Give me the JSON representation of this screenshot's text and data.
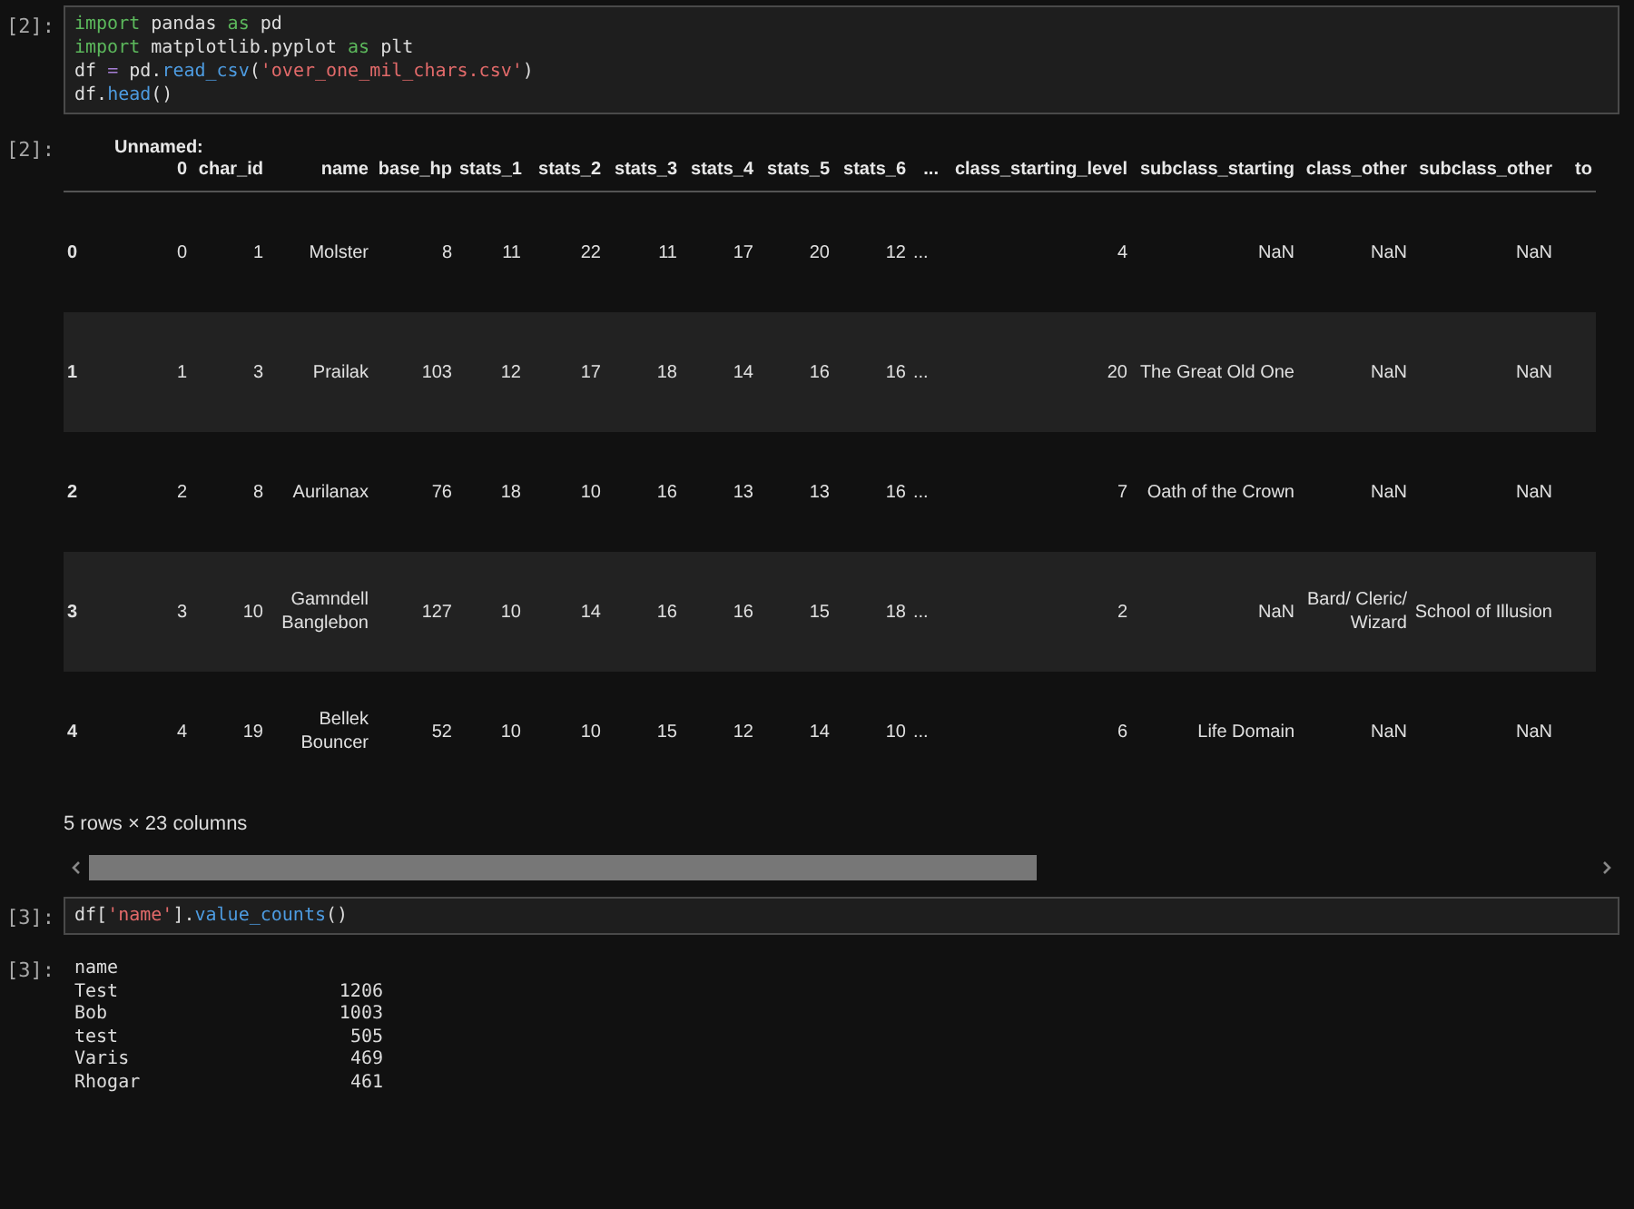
{
  "cells": [
    {
      "kind": "code",
      "prompt": "[2]:",
      "lines": [
        [
          {
            "text": "import",
            "kind": "keyword"
          },
          {
            "text": " pandas ",
            "kind": "plain"
          },
          {
            "text": "as",
            "kind": "keyword"
          },
          {
            "text": " pd",
            "kind": "plain"
          }
        ],
        [
          {
            "text": "import",
            "kind": "keyword"
          },
          {
            "text": " matplotlib.pyplot ",
            "kind": "plain"
          },
          {
            "text": "as",
            "kind": "keyword"
          },
          {
            "text": " plt",
            "kind": "plain"
          }
        ],
        [
          {
            "text": "df ",
            "kind": "plain"
          },
          {
            "text": "=",
            "kind": "operator"
          },
          {
            "text": " pd.",
            "kind": "plain"
          },
          {
            "text": "read_csv",
            "kind": "function"
          },
          {
            "text": "(",
            "kind": "plain"
          },
          {
            "text": "'over_one_mil_chars.csv'",
            "kind": "string"
          },
          {
            "text": ")",
            "kind": "plain"
          }
        ],
        [
          {
            "text": "df.",
            "kind": "plain"
          },
          {
            "text": "head",
            "kind": "function"
          },
          {
            "text": "()",
            "kind": "plain"
          }
        ]
      ]
    },
    {
      "kind": "table",
      "prompt": "[2]:",
      "columns": [
        "",
        "Unnamed: 0",
        "char_id",
        "name",
        "base_hp",
        "stats_1",
        "stats_2",
        "stats_3",
        "stats_4",
        "stats_5",
        "stats_6",
        "...",
        "class_starting_level",
        "subclass_starting",
        "class_other",
        "subclass_other",
        "to"
      ],
      "rows": [
        [
          "0",
          "0",
          "1",
          "Molster",
          "8",
          "11",
          "22",
          "11",
          "17",
          "20",
          "12",
          "...",
          "4",
          "NaN",
          "NaN",
          "NaN"
        ],
        [
          "1",
          "1",
          "3",
          "Prailak",
          "103",
          "12",
          "17",
          "18",
          "14",
          "16",
          "16",
          "...",
          "20",
          "The Great Old One",
          "NaN",
          "NaN"
        ],
        [
          "2",
          "2",
          "8",
          "Aurilanax",
          "76",
          "18",
          "10",
          "16",
          "13",
          "13",
          "16",
          "...",
          "7",
          "Oath of the Crown",
          "NaN",
          "NaN"
        ],
        [
          "3",
          "3",
          "10",
          "Gamndell Banglebon",
          "127",
          "10",
          "14",
          "16",
          "16",
          "15",
          "18",
          "...",
          "2",
          "NaN",
          "Bard/ Cleric/ Wizard",
          "School of Illusion"
        ],
        [
          "4",
          "4",
          "19",
          "Bellek Bouncer",
          "52",
          "10",
          "10",
          "15",
          "12",
          "14",
          "10",
          "...",
          "6",
          "Life Domain",
          "NaN",
          "NaN"
        ]
      ],
      "summary": "5 rows × 23 columns"
    },
    {
      "kind": "code",
      "prompt": "[3]:",
      "lines": [
        [
          {
            "text": "df[",
            "kind": "plain"
          },
          {
            "text": "'name'",
            "kind": "string"
          },
          {
            "text": "].",
            "kind": "plain"
          },
          {
            "text": "value_counts",
            "kind": "function"
          },
          {
            "text": "()",
            "kind": "plain"
          }
        ]
      ]
    },
    {
      "kind": "series",
      "prompt": "[3]:",
      "header": "name",
      "rows": [
        {
          "label": "Test",
          "count": "1206"
        },
        {
          "label": "Bob",
          "count": "1003"
        },
        {
          "label": "test",
          "count": "505"
        },
        {
          "label": "Varis",
          "count": "469"
        },
        {
          "label": "Rhogar",
          "count": "461"
        }
      ]
    }
  ]
}
